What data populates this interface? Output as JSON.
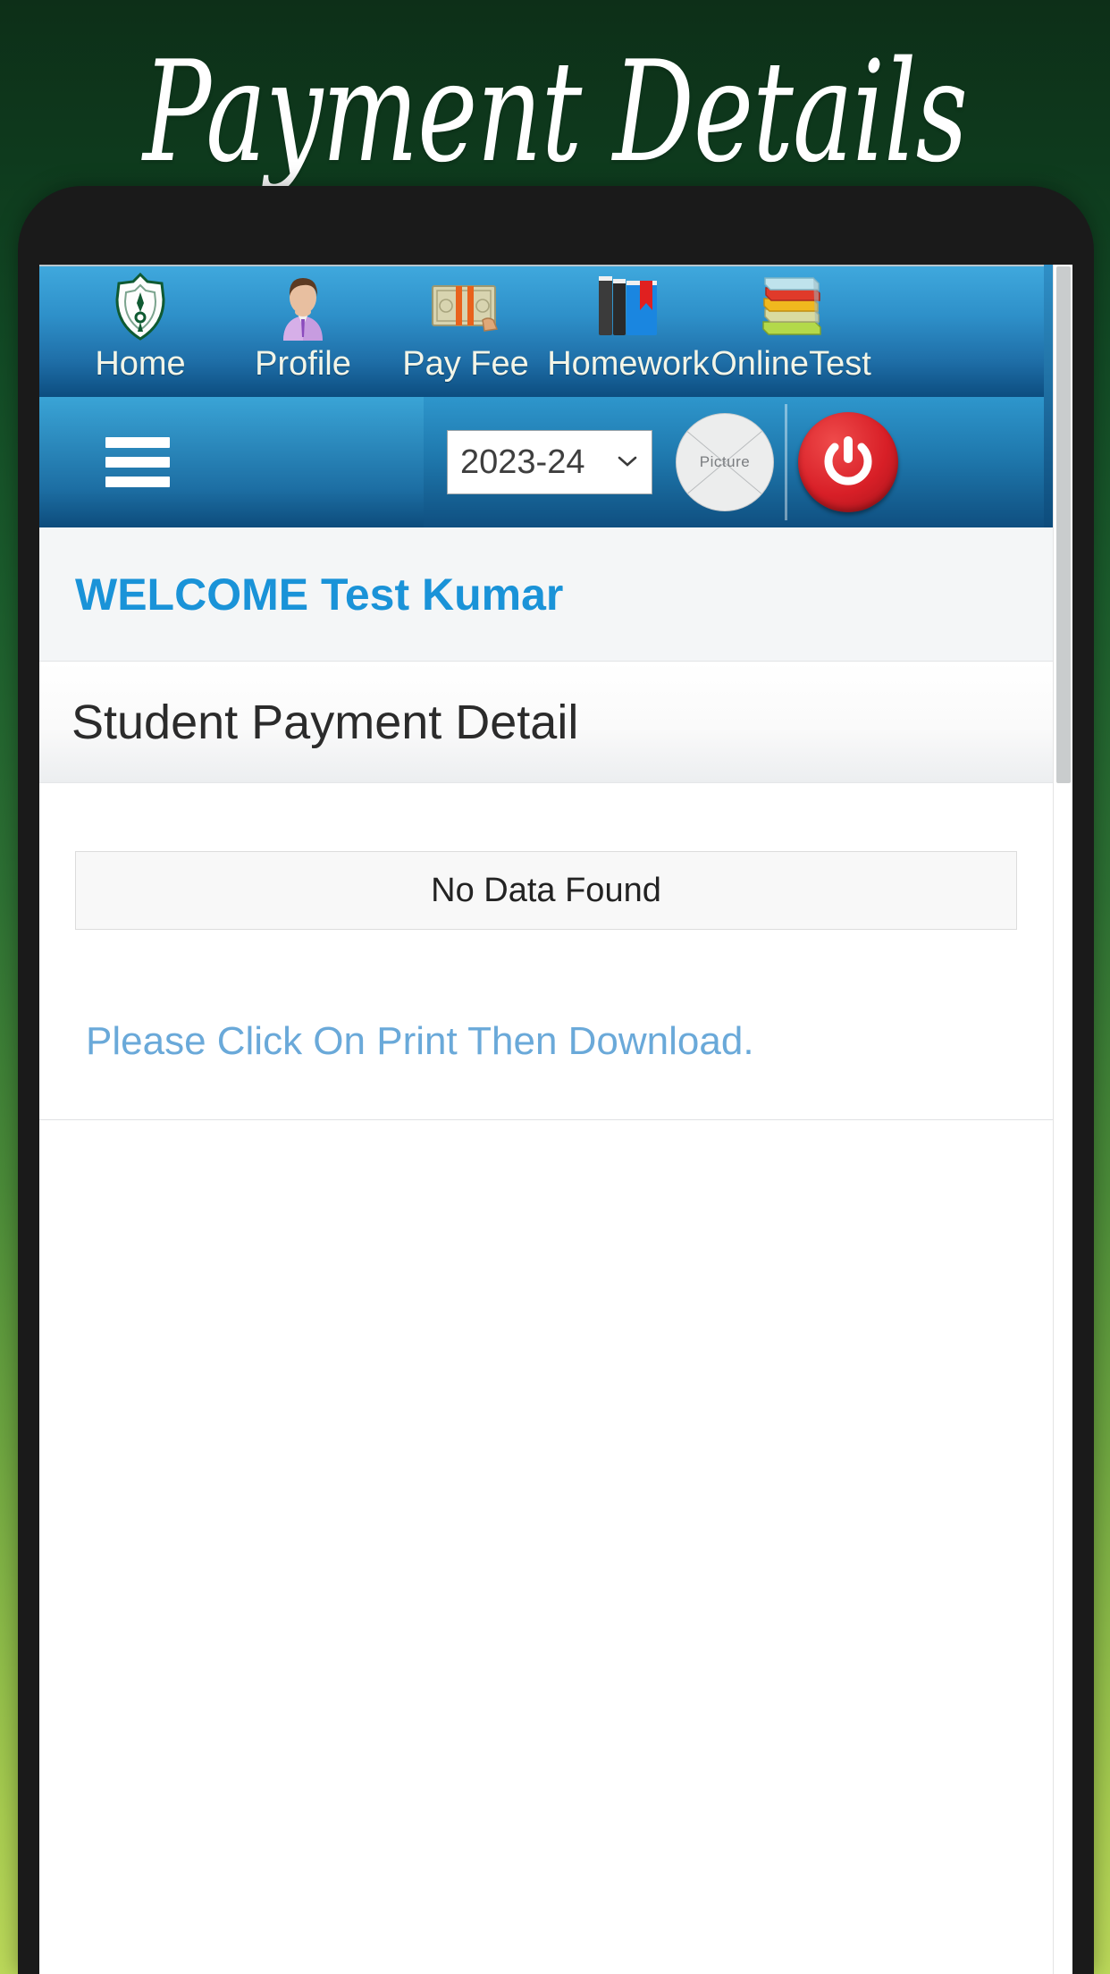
{
  "promo": {
    "title": "Payment Details"
  },
  "app": {
    "icon_nav": [
      {
        "label": "Home",
        "icon": "school-crest-icon"
      },
      {
        "label": "Profile",
        "icon": "user-avatar-icon"
      },
      {
        "label": "Pay Fee",
        "icon": "money-cash-icon"
      },
      {
        "label": "Homework",
        "icon": "books-bookmark-icon"
      },
      {
        "label": "OnlineTest",
        "icon": "book-stack-icon"
      }
    ],
    "toolbar": {
      "menu_icon": "hamburger-menu-icon",
      "session_value": "2023-24",
      "session_caret_icon": "chevron-down-icon",
      "avatar_placeholder_label": "Picture",
      "avatar_icon": "broken-image-avatar-icon",
      "power_icon": "power-logout-icon"
    },
    "welcome": {
      "prefix": "WELCOME",
      "user_name": "Test Kumar"
    },
    "page": {
      "heading": "Student Payment Detail",
      "no_data_message": "No Data Found",
      "print_hint": "Please Click On Print Then Download."
    }
  },
  "colors": {
    "accent_blue": "#1a93d8",
    "nav_blue_light": "#3fa8dd",
    "nav_blue_dark": "#0c4d80",
    "power_red": "#d81f27",
    "hint_blue": "#6aa9d9",
    "promo_green_top": "#0d2f18",
    "promo_green_bottom": "#bcd95a"
  }
}
